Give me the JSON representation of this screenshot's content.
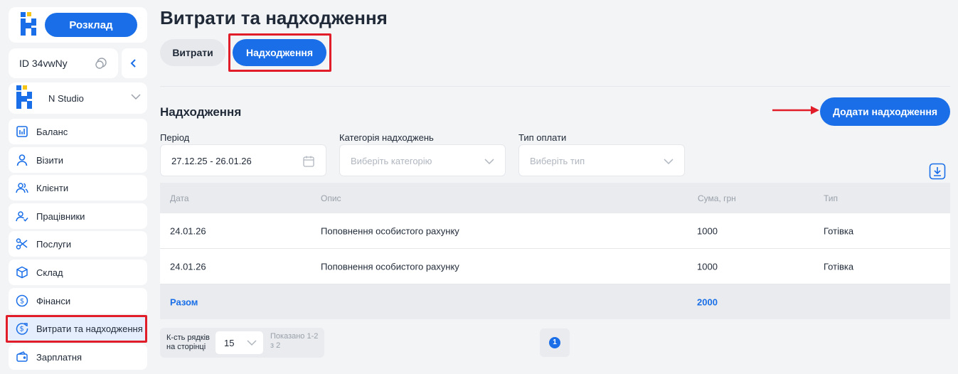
{
  "sidebar": {
    "schedule_button": "Розклад",
    "account_id": "ID 34vwNy",
    "studio_name": "N Studio",
    "items": [
      {
        "label": "Баланс",
        "icon": "wallet-icon"
      },
      {
        "label": "Візити",
        "icon": "user-icon"
      },
      {
        "label": "Клієнти",
        "icon": "users-icon"
      },
      {
        "label": "Працівники",
        "icon": "user-check-icon"
      },
      {
        "label": "Послуги",
        "icon": "scissors-icon"
      },
      {
        "label": "Склад",
        "icon": "box-icon"
      },
      {
        "label": "Фінанси",
        "icon": "dollar-circle-icon"
      },
      {
        "label": "Витрати та надходження",
        "icon": "dollar-exchange-icon",
        "active": true
      },
      {
        "label": "Зарплатня",
        "icon": "purse-icon"
      }
    ]
  },
  "page": {
    "title": "Витрати та надходження",
    "tabs": [
      {
        "label": "Витрати",
        "active": false
      },
      {
        "label": "Надходження",
        "active": true
      }
    ],
    "section_title": "Надходження",
    "add_button": "Додати надходження"
  },
  "filters": {
    "period": {
      "label": "Період",
      "value": "27.12.25 - 26.01.26"
    },
    "category": {
      "label": "Категорія надходжень",
      "placeholder": "Виберіть категорію"
    },
    "payment_type": {
      "label": "Тип оплати",
      "placeholder": "Виберіть тип"
    }
  },
  "table": {
    "columns": [
      "Дата",
      "Опис",
      "Сума, грн",
      "Тип"
    ],
    "rows": [
      {
        "date": "24.01.26",
        "description": "Поповнення особистого рахунку",
        "amount": "1000",
        "type": "Готівка"
      },
      {
        "date": "24.01.26",
        "description": "Поповнення особистого рахунку",
        "amount": "1000",
        "type": "Готівка"
      }
    ],
    "total_label": "Разом",
    "total_amount": "2000"
  },
  "pagination": {
    "rows_per_page_label": "К-сть рядків на сторінці",
    "rows_per_page": "15",
    "shown_text": "Показано 1-2 з 2",
    "current_page": "1"
  },
  "colors": {
    "accent": "#1a6fe8",
    "highlight": "#e11d2a",
    "background": "#f3f4f6"
  }
}
